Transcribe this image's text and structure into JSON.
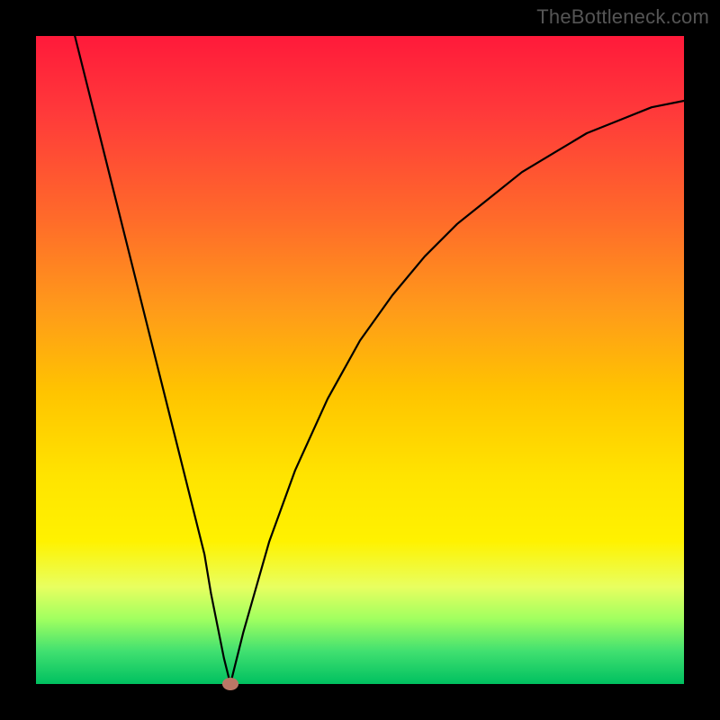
{
  "watermark": "TheBottleneck.com",
  "chart_data": {
    "type": "line",
    "title": "",
    "xlabel": "",
    "ylabel": "",
    "xlim": [
      0,
      100
    ],
    "ylim": [
      0,
      100
    ],
    "minimum_x": 30,
    "marker": {
      "x": 30,
      "y": 0,
      "color": "#bb7766"
    },
    "curve_points": [
      {
        "x": 6,
        "y": 100
      },
      {
        "x": 8,
        "y": 92
      },
      {
        "x": 10,
        "y": 84
      },
      {
        "x": 12,
        "y": 76
      },
      {
        "x": 14,
        "y": 68
      },
      {
        "x": 16,
        "y": 60
      },
      {
        "x": 18,
        "y": 52
      },
      {
        "x": 20,
        "y": 44
      },
      {
        "x": 22,
        "y": 36
      },
      {
        "x": 24,
        "y": 28
      },
      {
        "x": 26,
        "y": 20
      },
      {
        "x": 27,
        "y": 14
      },
      {
        "x": 28,
        "y": 9
      },
      {
        "x": 29,
        "y": 4
      },
      {
        "x": 30,
        "y": 0
      },
      {
        "x": 31,
        "y": 4
      },
      {
        "x": 32,
        "y": 8
      },
      {
        "x": 34,
        "y": 15
      },
      {
        "x": 36,
        "y": 22
      },
      {
        "x": 40,
        "y": 33
      },
      {
        "x": 45,
        "y": 44
      },
      {
        "x": 50,
        "y": 53
      },
      {
        "x": 55,
        "y": 60
      },
      {
        "x": 60,
        "y": 66
      },
      {
        "x": 65,
        "y": 71
      },
      {
        "x": 70,
        "y": 75
      },
      {
        "x": 75,
        "y": 79
      },
      {
        "x": 80,
        "y": 82
      },
      {
        "x": 85,
        "y": 85
      },
      {
        "x": 90,
        "y": 87
      },
      {
        "x": 95,
        "y": 89
      },
      {
        "x": 100,
        "y": 90
      }
    ],
    "gradient_stops": [
      {
        "pos": 0,
        "color": "#ff1a3a"
      },
      {
        "pos": 28,
        "color": "#ff6a2a"
      },
      {
        "pos": 55,
        "color": "#ffc400"
      },
      {
        "pos": 78,
        "color": "#fff200"
      },
      {
        "pos": 100,
        "color": "#00c060"
      }
    ]
  }
}
